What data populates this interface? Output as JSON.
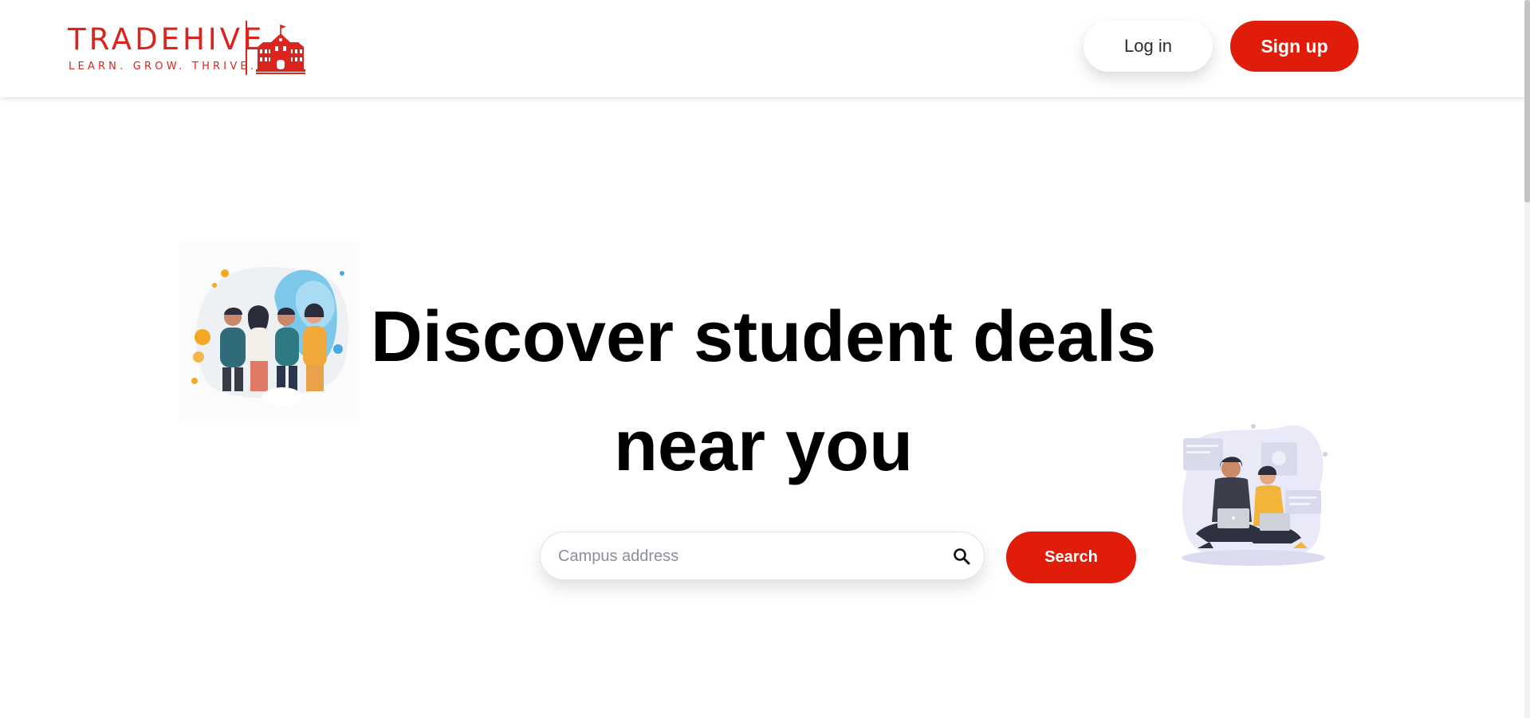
{
  "brand": {
    "name": "TRADEHIVE",
    "tagline": "LEARN. GROW. THRIVE.",
    "color": "#d9251d"
  },
  "header": {
    "login_label": "Log in",
    "signup_label": "Sign up"
  },
  "hero": {
    "title": "Discover student deals near you",
    "search_placeholder": "Campus address",
    "search_button_label": "Search"
  },
  "icons": {
    "logo": "school-building-icon",
    "search": "magnifier-search-icon"
  },
  "colors": {
    "accent": "#e01d0b",
    "background": "#ffffff",
    "text": "#000000"
  }
}
